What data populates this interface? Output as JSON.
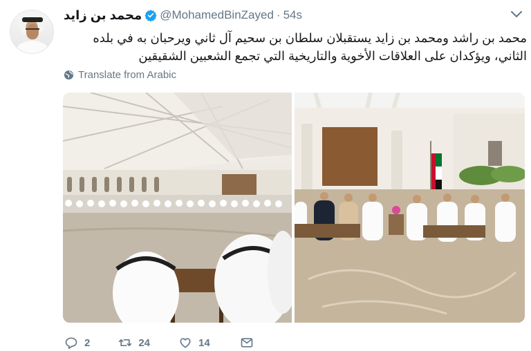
{
  "tweet": {
    "author": {
      "display_name": "محمد بن زايد",
      "handle": "@MohamedBinZayed",
      "verified": true
    },
    "separator": "·",
    "time": "54s",
    "text": "محمد بن راشد ومحمد بن زايد يستقبلان سلطان بن سحيم آل ثاني ويرحبان به في بلده الثاني، ويؤكدان  على العلاقات الأخوية والتاريخية التي تجمع الشعبين الشقيقين",
    "translate_label": "Translate from Arabic",
    "actions": {
      "replies": "2",
      "retweets": "24",
      "likes": "14"
    },
    "icons": {
      "verified": "verified-badge-icon",
      "menu": "chevron-down-icon",
      "translate": "globe-icon",
      "reply": "reply-icon",
      "retweet": "retweet-icon",
      "like": "heart-icon",
      "message": "direct-message-icon"
    },
    "colors": {
      "verified": "#1da1f2",
      "text": "#14171a",
      "secondary": "#657786"
    }
  }
}
